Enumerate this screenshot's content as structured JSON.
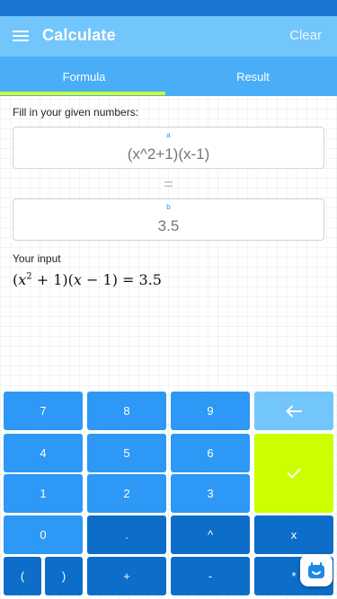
{
  "app_bar": {
    "title": "Calculate",
    "clear_label": "Clear",
    "menu_icon": "hamburger-menu-icon"
  },
  "tabs": [
    {
      "label": "Formula",
      "selected": true
    },
    {
      "label": "Result",
      "selected": false
    }
  ],
  "content": {
    "instruction": "Fill in your given numbers:",
    "field_a": {
      "label": "a",
      "value": "(x^2+1)(x-1)"
    },
    "equals": "=",
    "field_b": {
      "label": "b",
      "value": "3.5"
    },
    "your_input_label": "Your input",
    "rendered_expression": {
      "open1": "(",
      "x1": "x",
      "exponent": "2",
      "plus1": " + 1)(",
      "x2": "x",
      "minus1": " − 1) = 3.5"
    }
  },
  "keypad": {
    "keys": {
      "k7": "7",
      "k8": "8",
      "k9": "9",
      "k4": "4",
      "k5": "5",
      "k6": "6",
      "k1": "1",
      "k2": "2",
      "k3": "3",
      "k0": "0",
      "dot": ".",
      "caret": "^",
      "times": "x",
      "lparen": "(",
      "rparen": ")",
      "plus": "+",
      "minus": "-",
      "multiply": "*"
    },
    "icons": {
      "backspace": "backspace-arrow-icon",
      "confirm": "checkmark-icon"
    }
  },
  "colors": {
    "status_bar": "#1a76d2",
    "app_bar": "#73c6fb",
    "tab_bar": "#49adf7",
    "tab_indicator": "#ccff33",
    "key_light": "#2d98f5",
    "key_dark": "#0c6ec8",
    "key_backspace": "#73c6fb",
    "key_confirm": "#ccff00"
  }
}
